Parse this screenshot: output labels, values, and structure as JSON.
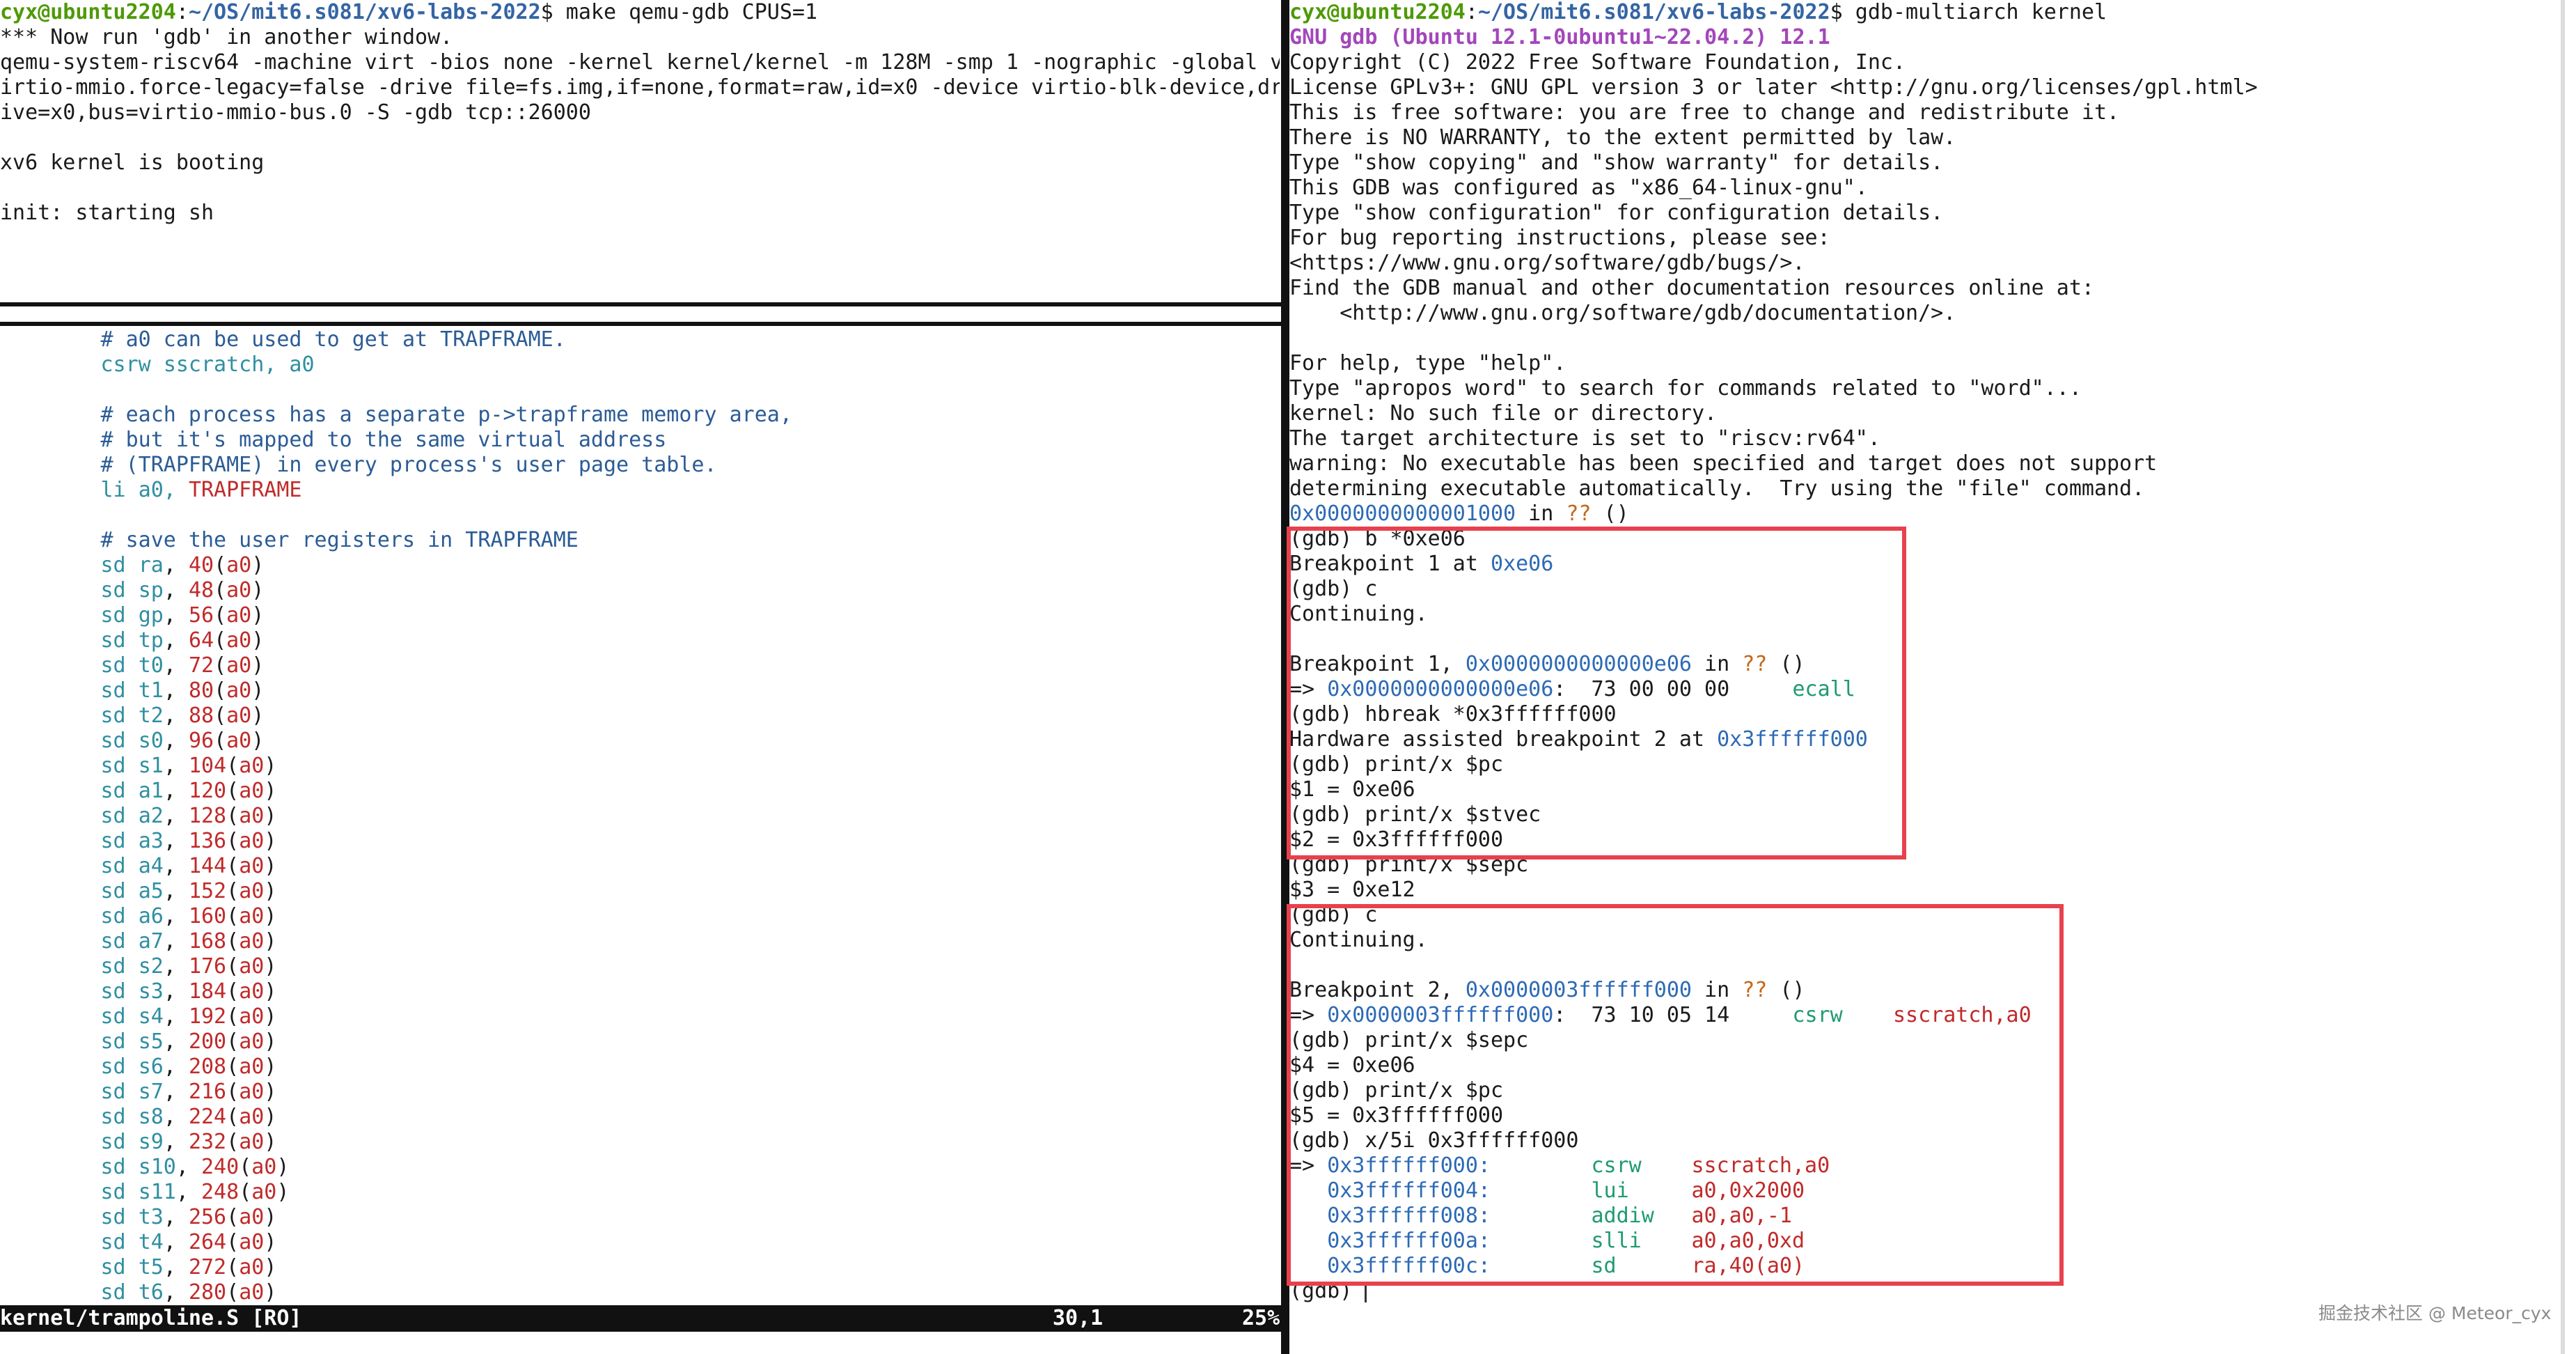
{
  "left_top": {
    "prompt_user": "cyx@ubuntu2204",
    "prompt_sep": ":",
    "prompt_path": "~/OS/mit6.s081/xv6-labs-2022",
    "prompt_cmd": "$ make qemu-gdb CPUS=1",
    "lines": [
      "*** Now run 'gdb' in another window.",
      "qemu-system-riscv64 -machine virt -bios none -kernel kernel/kernel -m 128M -smp 1 -nographic -global v",
      "irtio-mmio.force-legacy=false -drive file=fs.img,if=none,format=raw,id=x0 -device virtio-blk-device,dr",
      "ive=x0,bus=virtio-mmio-bus.0 -S -gdb tcp::26000",
      "",
      "xv6 kernel is booting",
      "",
      "init: starting sh"
    ]
  },
  "editor": {
    "comments": [
      "# a0 can be used to get at TRAPFRAME.",
      "# each process has a separate p->trapframe memory area,",
      "# but it's mapped to the same virtual address",
      "# (TRAPFRAME) in every process's user page table.",
      "# save the user registers in TRAPFRAME"
    ],
    "csrw": {
      "op": "csrw",
      "args": "sscratch, a0"
    },
    "li": {
      "op": "li",
      "args": "a0, ",
      "sym": "TRAPFRAME"
    },
    "stores": [
      {
        "reg": "ra",
        "off": "40"
      },
      {
        "reg": "sp",
        "off": "48"
      },
      {
        "reg": "gp",
        "off": "56"
      },
      {
        "reg": "tp",
        "off": "64"
      },
      {
        "reg": "t0",
        "off": "72"
      },
      {
        "reg": "t1",
        "off": "80"
      },
      {
        "reg": "t2",
        "off": "88"
      },
      {
        "reg": "s0",
        "off": "96"
      },
      {
        "reg": "s1",
        "off": "104"
      },
      {
        "reg": "a1",
        "off": "120"
      },
      {
        "reg": "a2",
        "off": "128"
      },
      {
        "reg": "a3",
        "off": "136"
      },
      {
        "reg": "a4",
        "off": "144"
      },
      {
        "reg": "a5",
        "off": "152"
      },
      {
        "reg": "a6",
        "off": "160"
      },
      {
        "reg": "a7",
        "off": "168"
      },
      {
        "reg": "s2",
        "off": "176"
      },
      {
        "reg": "s3",
        "off": "184"
      },
      {
        "reg": "s4",
        "off": "192"
      },
      {
        "reg": "s5",
        "off": "200"
      },
      {
        "reg": "s6",
        "off": "208"
      },
      {
        "reg": "s7",
        "off": "216"
      },
      {
        "reg": "s8",
        "off": "224"
      },
      {
        "reg": "s9",
        "off": "232"
      },
      {
        "reg": "s10",
        "off": "240"
      },
      {
        "reg": "s11",
        "off": "248"
      },
      {
        "reg": "t3",
        "off": "256"
      },
      {
        "reg": "t4",
        "off": "264"
      },
      {
        "reg": "t5",
        "off": "272"
      },
      {
        "reg": "t6",
        "off": "280"
      }
    ],
    "store_op": "sd",
    "base_reg": "a0"
  },
  "status": {
    "file": "kernel/trampoline.S [RO]",
    "pos": "30,1",
    "pct": "25%"
  },
  "gdb": {
    "prompt_user": "cyx@ubuntu2204",
    "prompt_path": "~/OS/mit6.s081/xv6-labs-2022",
    "prompt_cmd": "$ gdb-multiarch kernel",
    "banner": "GNU gdb (Ubuntu 12.1-0ubuntu1~22.04.2) 12.1",
    "intro": [
      "Copyright (C) 2022 Free Software Foundation, Inc.",
      "License GPLv3+: GNU GPL version 3 or later <http://gnu.org/licenses/gpl.html>",
      "This is free software: you are free to change and redistribute it.",
      "There is NO WARRANTY, to the extent permitted by law.",
      "Type \"show copying\" and \"show warranty\" for details.",
      "This GDB was configured as \"x86_64-linux-gnu\".",
      "Type \"show configuration\" for configuration details.",
      "For bug reporting instructions, please see:",
      "<https://www.gnu.org/software/gdb/bugs/>.",
      "Find the GDB manual and other documentation resources online at:",
      "    <http://www.gnu.org/software/gdb/documentation/>.",
      "",
      "For help, type \"help\".",
      "Type \"apropos word\" to search for commands related to \"word\"...",
      "kernel: No such file or directory.",
      "The target architecture is set to \"riscv:rv64\".",
      "warning: No executable has been specified and target does not support",
      "determining executable automatically.  Try using the \"file\" command."
    ],
    "start_addr": "0x0000000000001000",
    "start_in": " in ",
    "qq": "??",
    "paren": " ()",
    "s1": {
      "cmd_b": "(gdb) b *0xe06",
      "bp1_text": "Breakpoint 1 at ",
      "bp1_addr": "0xe06",
      "cmd_c": "(gdb) c",
      "continuing": "Continuing.",
      "hit_text": "Breakpoint 1, ",
      "hit_addr": "0x0000000000000e06",
      "arrow": "=> ",
      "cur_addr": "0x0000000000000e06",
      "cur_bytes": ":  73 00 00 00     ",
      "cur_ins": "ecall",
      "cmd_hb": "(gdb) hbreak *0x3ffffff000",
      "hb_text": "Hardware assisted breakpoint 2 at ",
      "hb_addr": "0x3ffffff000",
      "cmd_pc": "(gdb) print/x $pc",
      "res_pc": "$1 = 0xe06",
      "cmd_stvec": "(gdb) print/x $stvec",
      "res_stvec": "$2 = 0x3ffffff000",
      "cmd_sepc": "(gdb) print/x $sepc",
      "res_sepc": "$3 = 0xe12"
    },
    "s2": {
      "cmd_c": "(gdb) c",
      "continuing": "Continuing.",
      "hit_text": "Breakpoint 2, ",
      "hit_addr": "0x0000003ffffff000",
      "cur_addr": "0x0000003ffffff000",
      "cur_bytes": ":  73 10 05 14     ",
      "cur_op": "csrw",
      "cur_args": "sscratch,a0",
      "cmd_sepc": "(gdb) print/x $sepc",
      "res_sepc": "$4 = 0xe06",
      "cmd_pc": "(gdb) print/x $pc",
      "res_pc": "$5 = 0x3ffffff000",
      "cmd_x": "(gdb) x/5i 0x3ffffff000",
      "disasm": [
        {
          "prefix": "=> ",
          "addr": "0x3ffffff000:",
          "op": "csrw",
          "args": "sscratch,a0"
        },
        {
          "prefix": "   ",
          "addr": "0x3ffffff004:",
          "op": "lui",
          "args": "a0,0x2000"
        },
        {
          "prefix": "   ",
          "addr": "0x3ffffff008:",
          "op": "addiw",
          "args": "a0,a0,-1"
        },
        {
          "prefix": "   ",
          "addr": "0x3ffffff00a:",
          "op": "slli",
          "args": "a0,a0,0xd"
        },
        {
          "prefix": "   ",
          "addr": "0x3ffffff00c:",
          "op": "sd",
          "args": "ra,40(a0)"
        }
      ],
      "final_prompt": "(gdb) "
    }
  },
  "watermark": "掘金技术社区 @ Meteor_cyx",
  "colors": {
    "highlight_box": "#e8414d",
    "prompt_green": "#4e9a06",
    "prompt_blue": "#3465a4"
  }
}
